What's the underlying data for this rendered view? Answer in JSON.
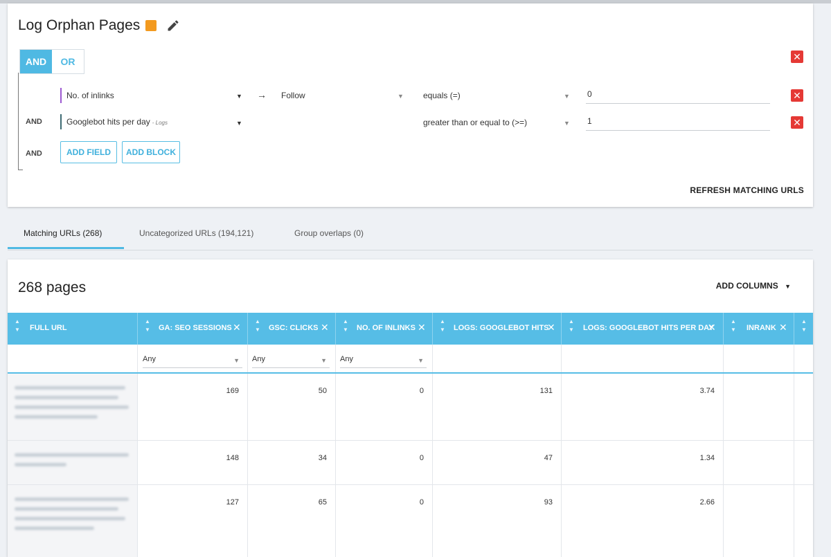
{
  "segment": {
    "title": "Log Orphan Pages",
    "swatch_color": "#f39a1f",
    "and_label": "AND",
    "or_label": "OR",
    "rows": [
      {
        "conj": "",
        "field": "No. of inlinks",
        "mod": "Follow",
        "op": "equals (=)",
        "value": "0",
        "bar_color": "#9c59d1"
      },
      {
        "conj": "AND",
        "field": "Googlebot hits per day",
        "tag": "- Logs",
        "op": "greater than or equal to (>=)",
        "value": "1",
        "bar_color": "#3e6b73"
      }
    ],
    "add_conj": "AND",
    "add_field": "ADD FIELD",
    "add_block": "ADD BLOCK",
    "refresh": "REFRESH MATCHING URLS"
  },
  "tabs": [
    "Matching URLs (268)",
    "Uncategorized URLs (194,121)",
    "Group overlaps (0)"
  ],
  "table": {
    "title": "268 pages",
    "add_columns": "ADD COLUMNS",
    "columns": [
      "FULL URL",
      "GA: SEO SESSIONS",
      "GSC: CLICKS",
      "NO. OF INLINKS",
      "LOGS: GOOGLEBOT HITS",
      "LOGS: GOOGLEBOT HITS PER DAY",
      "INRANK"
    ],
    "filters": [
      "Any",
      "Any",
      "Any"
    ],
    "rows": [
      [
        "169",
        "50",
        "0",
        "131",
        "3.74",
        ""
      ],
      [
        "148",
        "34",
        "0",
        "47",
        "1.34",
        ""
      ],
      [
        "127",
        "65",
        "0",
        "93",
        "2.66",
        ""
      ]
    ]
  },
  "icons": {
    "edit": "pencil-icon",
    "remove": "close-icon",
    "arrow": "arrow-right-icon",
    "dropdown": "caret-down-icon",
    "sort": "sort-icon"
  }
}
